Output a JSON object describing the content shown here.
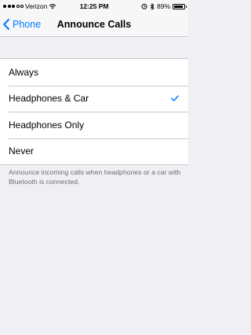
{
  "status_bar": {
    "carrier": "Verizon",
    "time": "12:25 PM",
    "battery_percent": "89%",
    "battery_level": 0.89,
    "icons": [
      "signal-dots-icon",
      "wifi-icon",
      "alarm-icon",
      "bluetooth-icon",
      "battery-icon"
    ]
  },
  "nav": {
    "back_label": "Phone",
    "title": "Announce Calls"
  },
  "options": [
    {
      "label": "Always",
      "selected": false
    },
    {
      "label": "Headphones & Car",
      "selected": true
    },
    {
      "label": "Headphones Only",
      "selected": false
    },
    {
      "label": "Never",
      "selected": false
    }
  ],
  "footer_note": "Announce incoming calls when headphones or a car with Bluetooth is connected.",
  "colors": {
    "accent": "#007aff",
    "background": "#efeff4",
    "separator": "#c8c7cc",
    "footer_text": "#6d6d72"
  }
}
